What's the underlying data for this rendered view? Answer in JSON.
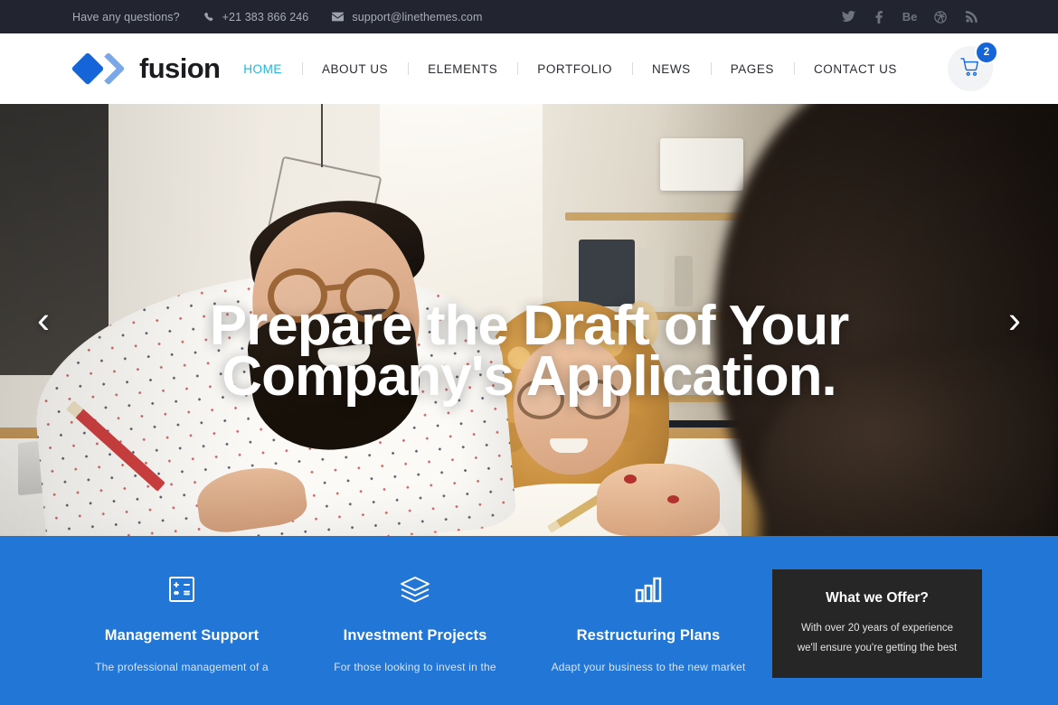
{
  "topbar": {
    "question": "Have any questions?",
    "phone": "+21 383 866 246",
    "email": "support@linethemes.com",
    "socials": [
      "twitter-icon",
      "facebook-icon",
      "behance-icon",
      "dribbble-icon",
      "rss-icon"
    ]
  },
  "header": {
    "brand": "fusion",
    "nav": [
      {
        "label": "HOME",
        "active": true
      },
      {
        "label": "ABOUT US",
        "active": false
      },
      {
        "label": "ELEMENTS",
        "active": false
      },
      {
        "label": "PORTFOLIO",
        "active": false
      },
      {
        "label": "NEWS",
        "active": false
      },
      {
        "label": "PAGES",
        "active": false
      },
      {
        "label": "CONTACT US",
        "active": false
      }
    ],
    "cart_count": "2",
    "active_color": "#1fb6d8",
    "accent_color": "#1565d8"
  },
  "hero": {
    "title_line1": "Prepare the Draft of Your",
    "title_line2": "Company's Application.",
    "prev_arrow": "‹",
    "next_arrow": "›"
  },
  "features": {
    "background_color": "#2176d6",
    "items": [
      {
        "icon": "calculator-icon",
        "title": "Management Support",
        "desc": "The professional management of a"
      },
      {
        "icon": "layers-icon",
        "title": "Investment Projects",
        "desc": "For those looking to invest in the"
      },
      {
        "icon": "bar-chart-icon",
        "title": "Restructuring Plans",
        "desc": "Adapt your business to the new market"
      }
    ],
    "offer": {
      "title": "What we Offer?",
      "line1": "With over 20 years of experience",
      "line2": "we'll ensure you're getting the best"
    }
  }
}
